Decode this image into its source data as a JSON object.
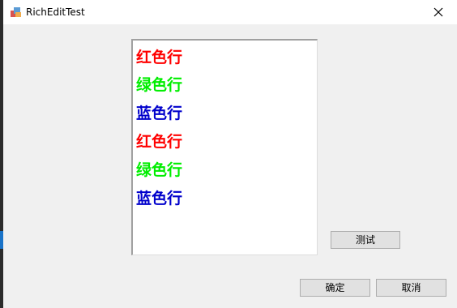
{
  "window": {
    "title": "RichEditTest"
  },
  "rich_edit": {
    "lines": [
      {
        "text": "红色行",
        "color": "#ff0000"
      },
      {
        "text": "绿色行",
        "color": "#00ee00"
      },
      {
        "text": "蓝色行",
        "color": "#0000cc"
      },
      {
        "text": "红色行",
        "color": "#ff0000"
      },
      {
        "text": "绿色行",
        "color": "#00ee00"
      },
      {
        "text": "蓝色行",
        "color": "#0000cc"
      }
    ]
  },
  "buttons": {
    "test_label": "测试",
    "ok_label": "确定",
    "cancel_label": "取消"
  },
  "icons": {
    "app": "app-icon",
    "close": "close-icon"
  }
}
